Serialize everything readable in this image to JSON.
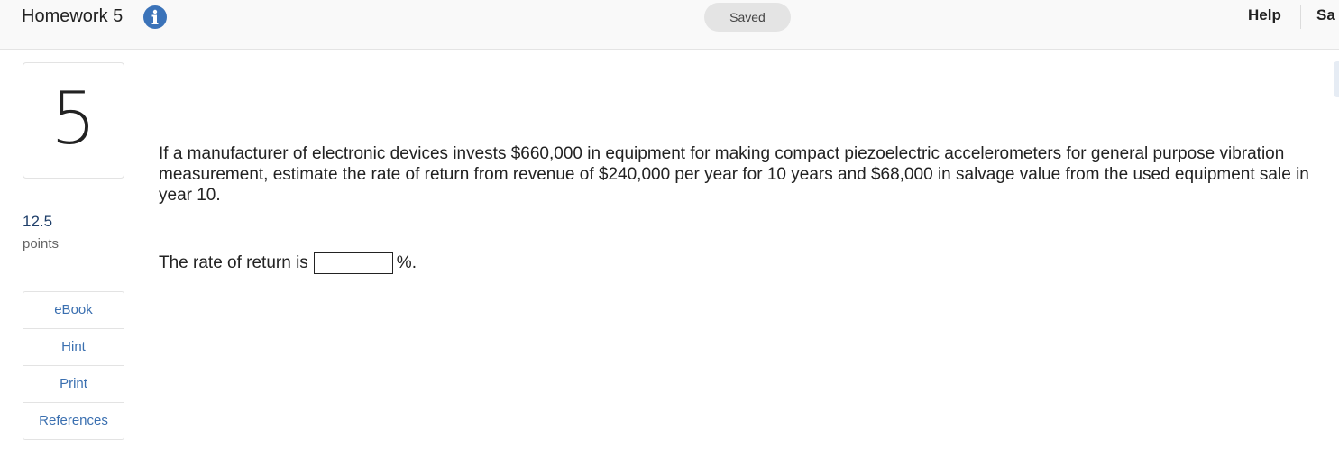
{
  "header": {
    "title": "Homework 5",
    "status": "Saved",
    "help_label": "Help",
    "save_exit_label": "Sa"
  },
  "question": {
    "number": "5",
    "points_value": "12.5",
    "points_label": "points",
    "text": "If a manufacturer of electronic devices invests $660,000 in equipment for making compact piezoelectric accelerometers for general purpose vibration measurement, estimate the rate of return from revenue of $240,000 per year for 10 years and $68,000 in salvage value from the used equipment sale in year 10.",
    "answer_prefix": "The rate of return is",
    "answer_value": "",
    "answer_suffix": "%."
  },
  "tools": [
    {
      "label": "eBook"
    },
    {
      "label": "Hint"
    },
    {
      "label": "Print"
    },
    {
      "label": "References"
    }
  ],
  "colors": {
    "info_icon": "#3b73b9",
    "link": "#3a6fb0",
    "points_value": "#1f3f6a"
  },
  "icons": {
    "info": "info-icon"
  }
}
